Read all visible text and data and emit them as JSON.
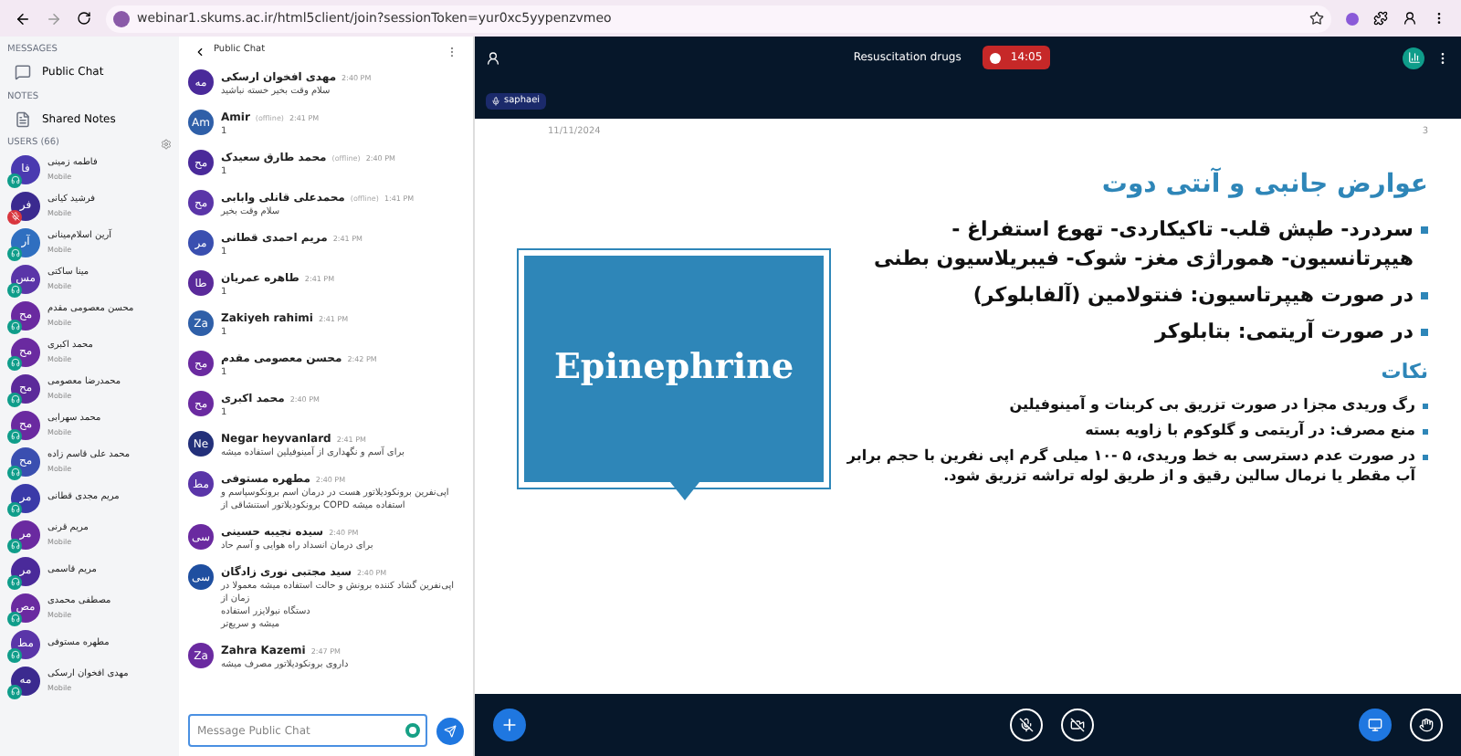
{
  "browser": {
    "url": "webinar1.skums.ac.ir/html5client/join?sessionToken=yur0xc5yypenzvmeo"
  },
  "sidebar": {
    "messages_heading": "MESSAGES",
    "public_chat": "Public Chat",
    "notes_heading": "NOTES",
    "shared_notes": "Shared Notes",
    "users_heading": "USERS (66)",
    "users": [
      {
        "initials": "فا",
        "name": "فاطمه زمینی",
        "device": "Mobile",
        "color": "#4a3ab0",
        "muted": false
      },
      {
        "initials": "فر",
        "name": "فرشید کیانی",
        "device": "Mobile",
        "color": "#3b2a8f",
        "muted": true
      },
      {
        "initials": "آر",
        "name": "آرین اسلام‌مینانی",
        "device": "Mobile",
        "color": "#2f6fc0",
        "muted": false
      },
      {
        "initials": "مس",
        "name": "مینا ساکتی",
        "device": "Mobile",
        "color": "#5a35a8",
        "muted": false
      },
      {
        "initials": "مح",
        "name": "محسن معصومی مقدم",
        "device": "Mobile",
        "color": "#6a2aa0",
        "muted": false
      },
      {
        "initials": "مح",
        "name": "محمد اکبری",
        "device": "Mobile",
        "color": "#6a2aa0",
        "muted": false
      },
      {
        "initials": "مح",
        "name": "محمدرضا معصومی",
        "device": "Mobile",
        "color": "#5b2a9a",
        "muted": false
      },
      {
        "initials": "مح",
        "name": "محمد سهرابی",
        "device": "Mobile",
        "color": "#6a2aa0",
        "muted": false
      },
      {
        "initials": "مح",
        "name": "محمد علی قاسم زاده",
        "device": "Mobile",
        "color": "#3a4fb0",
        "muted": false
      },
      {
        "initials": "مر",
        "name": "مریم مجدی قطانی",
        "color": "#3a3aa8",
        "muted": false
      },
      {
        "initials": "مر",
        "name": "مریم قرنی",
        "device": "Mobile",
        "color": "#6a2aa0",
        "muted": false
      },
      {
        "initials": "مر",
        "name": "مریم قاسمی",
        "color": "#4a2a9a",
        "muted": false
      },
      {
        "initials": "مص",
        "name": "مصطفی محمدی",
        "device": "Mobile",
        "color": "#6a2aa0",
        "muted": false
      },
      {
        "initials": "مط",
        "name": "مطهره مستوفی",
        "color": "#5a35a8",
        "muted": false
      },
      {
        "initials": "مه",
        "name": "مهدی افخوان ارسکی",
        "device": "Mobile",
        "color": "#3b2a8f",
        "muted": false
      }
    ]
  },
  "chat": {
    "title": "Public Chat",
    "placeholder": "Message Public Chat",
    "messages": [
      {
        "initials": "مه",
        "name": "مهدی افخوان ارسکی",
        "time": "2:40 PM",
        "color": "#4a2a9a",
        "lines": [
          "سلام وقت بخیر خسته نباشید"
        ]
      },
      {
        "initials": "Am",
        "name": "Amir",
        "offline": "(offline)",
        "time": "2:41 PM",
        "color": "#2f5fa8",
        "lines": [
          "1"
        ]
      },
      {
        "initials": "مح",
        "name": "محمد طارق سعیدک",
        "offline": "(offline)",
        "time": "2:40 PM",
        "color": "#4a2a9a",
        "lines": [
          "1"
        ]
      },
      {
        "initials": "مح",
        "name": "محمدعلی قانلی وابابی",
        "offline": "(offline)",
        "time": "1:41 PM",
        "color": "#5a35a8",
        "lines": [
          "سلام وقت بخیر"
        ]
      },
      {
        "initials": "مر",
        "name": "مریم احمدی قطانی",
        "time": "2:41 PM",
        "color": "#3a4fb0",
        "lines": [
          "1"
        ]
      },
      {
        "initials": "طا",
        "name": "طاهره عمریان",
        "time": "2:41 PM",
        "color": "#5a2a9a",
        "lines": [
          "1"
        ]
      },
      {
        "initials": "Za",
        "name": "Zakiyeh rahimi",
        "time": "2:41 PM",
        "color": "#2f5fa8",
        "lines": [
          "1"
        ]
      },
      {
        "initials": "مح",
        "name": "محسن معصومی مقدم",
        "time": "2:42 PM",
        "color": "#6a2aa0",
        "lines": [
          "1"
        ]
      },
      {
        "initials": "مح",
        "name": "محمد اکبری",
        "time": "2:40 PM",
        "color": "#6a2aa0",
        "lines": [
          "1"
        ]
      },
      {
        "initials": "Ne",
        "name": "Negar heyvanlard",
        "time": "2:41 PM",
        "color": "#23307a",
        "lines": [
          "برای آسم و نگهداری از آمینوفیلین استفاده میشه"
        ]
      },
      {
        "initials": "مط",
        "name": "مطهره مستوفی",
        "time": "2:40 PM",
        "color": "#5a35a8",
        "lines": [
          "اپی‌نفرین برونکودیلاتور هست در درمان اسم برونکوسپاسم و",
          "استفاده میشه COPD برونکودیلاتور استنشاقی از"
        ]
      },
      {
        "initials": "سی",
        "name": "سیده نجیبه حسینی",
        "time": "2:40 PM",
        "color": "#6a2aa0",
        "lines": [
          "برای درمان انسداد راه هوایی و آسم حاد"
        ]
      },
      {
        "initials": "سی",
        "name": "سید مجتبی نوری زادگان",
        "time": "2:40 PM",
        "color": "#1f4fa0",
        "lines": [
          "اپی‌نفرین گشاد کننده برونش و حالت استفاده میشه معمولا در زمان از",
          "دستگاه نبولایزر استفاده",
          "میشه و سریع‌تر"
        ]
      },
      {
        "initials": "Za",
        "name": "Zahra Kazemi",
        "time": "2:47 PM",
        "color": "#6a2aa0",
        "lines": [
          "داروی برونکودیلاتور مصرف میشه"
        ]
      }
    ]
  },
  "meeting": {
    "title": "Resuscitation drugs",
    "timer": "14:05",
    "presenter": "saphaei"
  },
  "slide": {
    "date": "11/11/2024",
    "page": "3",
    "banner": "Epinephrine",
    "heading": "عوارض جانبی و آنتی دوت",
    "bullets": [
      "سردرد- طپش قلب- تاکیکاردی- تهوع استفراغ - هیپرتانسیون- هموراژی مغز- شوک- فیبریلاسیون بطنی",
      "در صورت هیپرتاسیون: فنتولامین (آلفابلوکر)",
      "در صورت آریتمی: بتابلوکر"
    ],
    "notes_heading": "نکات",
    "notes": [
      "رگ وریدی مجزا در صورت تزریق بی کربنات و آمینوفیلین",
      "منع مصرف: در آریتمی و گلوکوم با زاویه بسته",
      "در صورت عدم دسترسی به خط وریدی، ۵ -۱۰ میلی گرم اپی نفرین با حجم برابر آب مقطر یا نرمال سالین رقیق و از طریق لوله تراشه تزریق شود."
    ]
  }
}
